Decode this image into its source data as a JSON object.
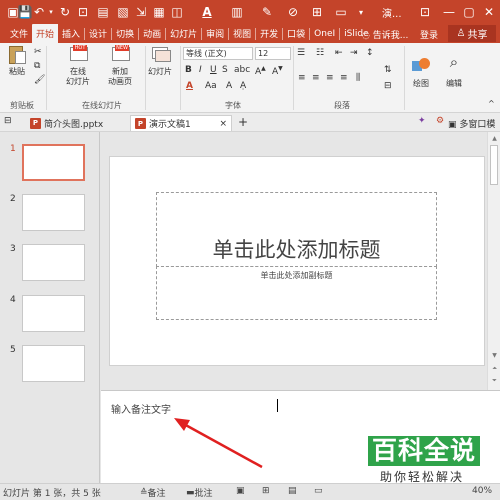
{
  "titlebar": {
    "title": "演...",
    "icons": [
      "save-icon",
      "undo-icon",
      "redo-icon",
      "start-icon",
      "text-box-icon",
      "image-icon",
      "shape-icon",
      "font-color-icon",
      "format-painter-icon"
    ]
  },
  "tabs": [
    "文件",
    "开始",
    "插入",
    "设计",
    "切换",
    "动画",
    "幻灯片",
    "审阅",
    "视图",
    "开发",
    "口袋",
    "OneI",
    "iSlide"
  ],
  "active_tab": "开始",
  "tell_me": "告诉我...",
  "login": "登录",
  "share": "共享",
  "ribbon": {
    "paste": "粘贴",
    "clipboard_group": "剪贴板",
    "online_slides": "在线\n幻灯片",
    "new_animation": "新加\n动画页",
    "online_slides_group": "在线幻灯片",
    "slides_btn": "幻灯片",
    "font_name": "等线 (正文)",
    "font_size": "12",
    "font_group": "字体",
    "paragraph_group": "段落",
    "drawing": "绘图",
    "editing": "编辑"
  },
  "doc_tabs": {
    "tab1": "简介头图.pptx",
    "tab2": "演示文稿1",
    "multi_window": "多窗口模式"
  },
  "thumbnails": [
    "1",
    "2",
    "3",
    "4",
    "5"
  ],
  "slide": {
    "title_placeholder": "单击此处添加标题",
    "subtitle_placeholder": "单击此处添加副标题"
  },
  "notes": {
    "text": "输入备注文字"
  },
  "status": {
    "slide_info": "幻灯片 第 1 张，共 5 张",
    "notes": "备注",
    "comments": "批注",
    "zoom": "40%"
  },
  "watermark": {
    "main": "百科全说",
    "sub": "助你轻松解决"
  },
  "colors": {
    "accent": "#c4442a",
    "arrow": "#e02020",
    "watermark": "#2fa34a"
  }
}
